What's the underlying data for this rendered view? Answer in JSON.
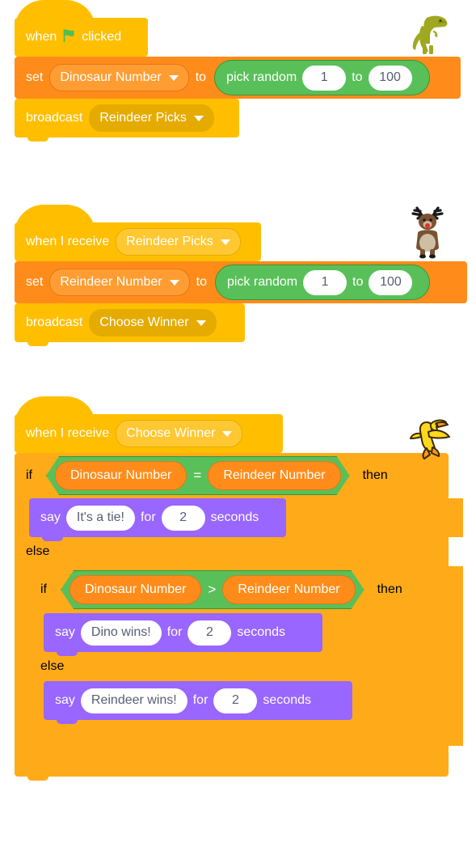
{
  "editor": {
    "name": "scratch-block-workspace",
    "background": "#ffffff"
  },
  "palette": {
    "events": "#ffbf00",
    "events_field": "#e6ab00",
    "variables": "#ff8c1a",
    "variables_field": "#ff9d33",
    "control": "#ffab19",
    "operators": "#59c059",
    "looks": "#9966ff",
    "input_text": "#575e75",
    "flag_green": "#4cbf56"
  },
  "scripts": [
    {
      "id": "dinosaur-script",
      "sprite": "dinosaur",
      "blocks": {
        "hat": {
          "when": "when",
          "flag_icon": "green-flag-icon",
          "clicked": "clicked"
        },
        "set": {
          "keyword": "set",
          "variable": "Dinosaur Number",
          "to": "to",
          "value": {
            "label": "pick random",
            "from": "1",
            "middle": "to",
            "until": "100"
          }
        },
        "broadcast": {
          "keyword": "broadcast",
          "message": "Reindeer Picks"
        }
      }
    },
    {
      "id": "reindeer-script",
      "sprite": "reindeer",
      "blocks": {
        "hat": {
          "keyword": "when I receive",
          "message": "Reindeer Picks"
        },
        "set": {
          "keyword": "set",
          "variable": "Reindeer Number",
          "to": "to",
          "value": {
            "label": "pick random",
            "from": "1",
            "middle": "to",
            "until": "100"
          }
        },
        "broadcast": {
          "keyword": "broadcast",
          "message": "Choose Winner"
        }
      }
    },
    {
      "id": "duck-script",
      "sprite": "duck",
      "blocks": {
        "hat": {
          "keyword": "when I receive",
          "message": "Choose Winner"
        },
        "outer_if": {
          "if": "if",
          "then": "then",
          "else": "else",
          "condition": {
            "left": "Dinosaur Number",
            "operator": "=",
            "right": "Reindeer Number"
          },
          "body": {
            "keyword": "say",
            "message": "It's a tie!",
            "for": "for",
            "seconds_value": "2",
            "seconds": "seconds"
          }
        },
        "inner_if": {
          "if": "if",
          "then": "then",
          "else": "else",
          "condition": {
            "left": "Dinosaur Number",
            "operator": ">",
            "right": "Reindeer Number"
          },
          "body": {
            "keyword": "say",
            "message": "Dino wins!",
            "for": "for",
            "seconds_value": "2",
            "seconds": "seconds"
          },
          "else_body": {
            "keyword": "say",
            "message": "Reindeer wins!",
            "for": "for",
            "seconds_value": "2",
            "seconds": "seconds"
          }
        }
      }
    }
  ],
  "sprites": {
    "dinosaur": {
      "name": "dinosaur-sprite",
      "body_color": "#a0a821",
      "dark_color": "#8a9018"
    },
    "reindeer": {
      "name": "reindeer-sprite",
      "body_color": "#8b5e3c",
      "belly_color": "#cdbfa3",
      "antler_color": "#1a1a1a",
      "nose_color": "#e03131"
    },
    "duck": {
      "name": "duck-sprite",
      "body_color": "#ffd91a",
      "beak_color": "#ff9a1f",
      "outline_color": "#3d2b00"
    }
  }
}
